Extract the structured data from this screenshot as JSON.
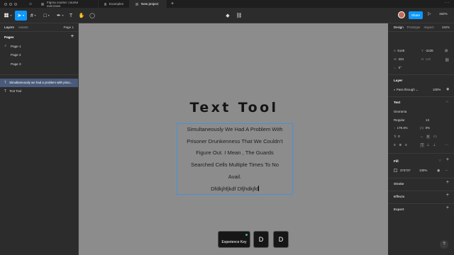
{
  "tabs": [
    {
      "label": "Figma course: course exercises",
      "active": false
    },
    {
      "label": "Examples",
      "active": false
    },
    {
      "label": "New project",
      "active": true
    }
  ],
  "tabbar": {
    "add": "+",
    "more": "···"
  },
  "toolbar": {
    "share_label": "Share",
    "zoom": "192%"
  },
  "left_panel": {
    "tab_layers": "Layers",
    "tab_assets": "Assets",
    "page_selector": "Page 1",
    "pages_heading": "Pages",
    "pages": [
      "Page 1",
      "Page 2",
      "Page 3"
    ],
    "layers": [
      {
        "label": "Simultaneously we had a problem with priso...",
        "selected": true
      },
      {
        "label": "Text Tool",
        "selected": false
      }
    ]
  },
  "canvas": {
    "heading": "Text Tool",
    "paragraph_lines": [
      "Simultaneously We Had A Problem With",
      "Prisoner Drunkenness That We Couldn't",
      "Figure Out. I Mean , The Guards",
      "Searched Cells Multiple Times To No",
      "Avail.",
      "Dfdkjhfjkdf Dfjhdkjfd"
    ],
    "keys": {
      "experience": "Experience Key",
      "d1": "D",
      "d2": "D"
    }
  },
  "right_panel": {
    "tab_design": "Design",
    "tab_prototype": "Prototype",
    "tab_inspect": "Inspect",
    "zoom": "192%",
    "x_label": "X",
    "x_value": "5149",
    "y_label": "Y",
    "y_value": "-2228",
    "w_label": "W",
    "w_value": "223",
    "h_label": "H",
    "h_value": "108",
    "rotation": "0°",
    "layer_heading": "Layer",
    "pass_through": "Pass through",
    "layer_opacity": "100%",
    "text_heading": "Text",
    "font_family": "Georama",
    "font_weight": "Regular",
    "font_size": "13",
    "line_height": "179.4%",
    "letter_spacing": "0%",
    "para_spacing": "0",
    "fill_heading": "Fill",
    "fill_hex": "373737",
    "fill_opacity": "100%",
    "stroke_heading": "Stroke",
    "effects_heading": "Effects",
    "export_heading": "Export"
  },
  "help": "?"
}
